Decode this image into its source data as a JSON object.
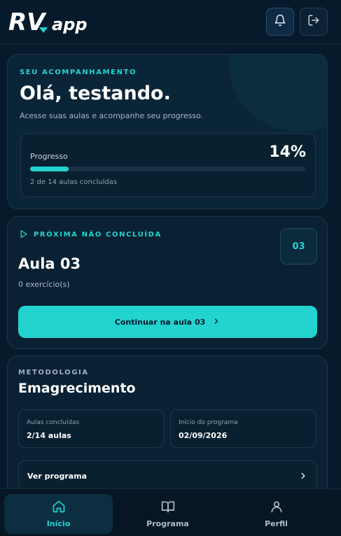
{
  "app": {
    "logo_rv": "RV",
    "logo_app": "app",
    "brand_accent": "#22d3cf"
  },
  "header": {
    "notifications_icon": "bell-icon",
    "logout_icon": "logout-icon"
  },
  "welcome": {
    "eyebrow": "SEU ACOMPANHAMENTO",
    "greeting": "Olá, testando.",
    "subtitle": "Acesse suas aulas e acompanhe seu progresso.",
    "progress_label": "Progresso",
    "progress_percent_text": "14%",
    "progress_fraction": 0.14,
    "progress_count": "2 de 14 aulas concluídas"
  },
  "next_lesson": {
    "eyebrow": "PRÓXIMA NÃO CONCLUÍDA",
    "number_badge": "03",
    "title": "Aula 03",
    "exercises": "0 exercício(s)",
    "cta_label": "Continuar na aula 03"
  },
  "methodology": {
    "eyebrow": "METODOLOGIA",
    "title": "Emagrecimento",
    "stats": [
      {
        "label": "Aulas concluídas",
        "value": "2/14 aulas"
      },
      {
        "label": "Início do programa",
        "value": "02/09/2026"
      }
    ],
    "link_label": "Ver programa"
  },
  "bottom_nav": {
    "items": [
      {
        "label": "Início",
        "icon": "home-icon",
        "active": true
      },
      {
        "label": "Programa",
        "icon": "book-icon",
        "active": false
      },
      {
        "label": "Perfil",
        "icon": "user-icon",
        "active": false
      }
    ]
  }
}
